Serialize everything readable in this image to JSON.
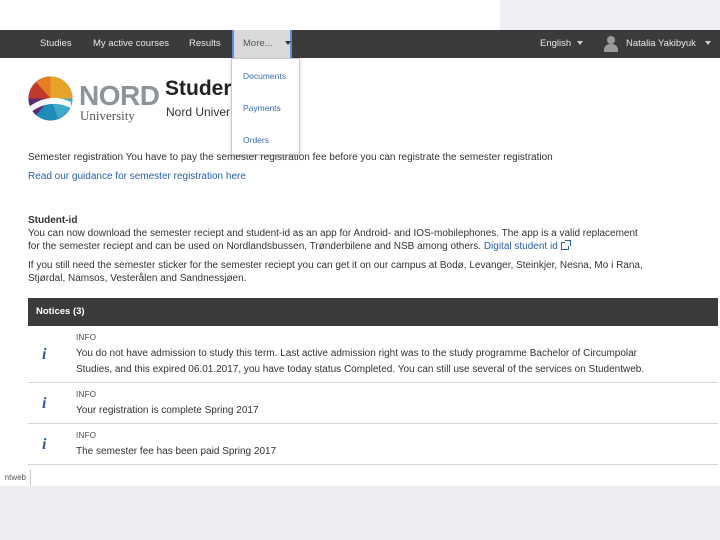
{
  "nav": {
    "items": [
      "Studies",
      "My active courses",
      "Results"
    ],
    "more_label": "More...",
    "language": "English",
    "user_name": "Natalia Yakibyuk"
  },
  "dropdown": {
    "items": [
      "Documents",
      "Payments",
      "Orders"
    ]
  },
  "header": {
    "logo_nord": "NORD",
    "logo_university": "University",
    "title": "Studer",
    "subtitle": "Nord Univer"
  },
  "registration": {
    "notice_text": "Semester registration You have to pay the semester registration fee before you can registrate the semester registration",
    "guidance_link": "Read our guidance for semester registration here"
  },
  "student_id": {
    "heading": "Student-id",
    "line1": "You can now download the semester reciept and student-id as an app for Android- and IOS-mobilephones. The app is a valid replacement",
    "line2": "for the semester reciept and can be used on Nordlandsbussen, Trønderbilene and NSB among others.",
    "link": "Digital student id",
    "line3": "If you still need the semester sticker for the semester reciept you can get it on our campus at Bodø, Levanger, Steinkjer, Nesna, Mo i Rana,",
    "line4": "Stjørdal, Namsos, Vesterålen and Sandnessjøen."
  },
  "notices": {
    "heading": "Notices (3)",
    "items": [
      {
        "label": "INFO",
        "line1": "You do not have admission to study this term. Last active admission right was to the study programme Bachelor of Circumpolar",
        "line2": "Studies, and this expired 06.01.2017, you have today status Completed. You can still use several of the services on Studentweb."
      },
      {
        "label": "INFO",
        "line1": "Your registration is complete Spring 2017"
      },
      {
        "label": "INFO",
        "line1": "The semester fee has been paid Spring 2017"
      }
    ]
  },
  "footer": {
    "tab_label": "ntweb"
  },
  "colors": {
    "navbar": "#3b3b3b",
    "link": "#2a5ea8",
    "accent_border": "#5b8fd6",
    "info_icon": "#2c5aa0"
  }
}
